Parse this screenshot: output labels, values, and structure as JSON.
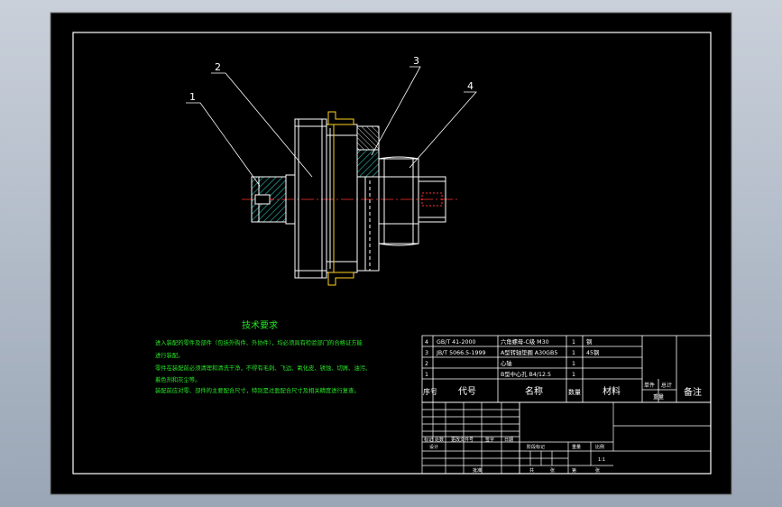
{
  "colors": {
    "outer_bg": "#a9b3c1",
    "paper": "#000000",
    "frame": "#ffffff",
    "hatch": "#2fd0c8",
    "note_text": "#27e627",
    "centerline": "#ff3333",
    "part_yellow": "#ffd21f",
    "title_block_line": "#ffffff"
  },
  "leaders": [
    {
      "num": "1"
    },
    {
      "num": "2"
    },
    {
      "num": "3"
    },
    {
      "num": "4"
    }
  ],
  "tech_requirements": {
    "title": "技术要求",
    "lines": [
      "进入装配的零件及部件（包括外购件、外协件），均必须具有检验部门的合格证方能",
      "进行装配。",
      "零件在装配前必须清理和清洗干净，不得有毛刺、飞边、氧化皮、锈蚀、切屑、油污、",
      "着色剂和灰尘等。",
      "装配前应对零、部件的主要配合尺寸，特别是过盈配合尺寸及相关精度进行复查。"
    ]
  },
  "bom": {
    "rows": [
      {
        "no": "4",
        "code": "GB/T 41-2000",
        "name": "六角螺母-C级 M30",
        "qty": "1",
        "material": "钢"
      },
      {
        "no": "3",
        "code": "JB/T 5066.5-1999",
        "name": "A型转轴垫圈 A30GB5",
        "qty": "1",
        "material": "45钢"
      },
      {
        "no": "2",
        "code": "",
        "name": "心轴",
        "qty": "1",
        "material": ""
      },
      {
        "no": "1",
        "code": "",
        "name": "B型中心孔 B4/12.5",
        "qty": "1",
        "material": ""
      }
    ],
    "header": {
      "no": "序号",
      "code": "代号",
      "name": "名称",
      "qty": "数量",
      "material": "材料",
      "unit": "单件",
      "total": "总计",
      "weight": "重量",
      "remark": "备注"
    }
  },
  "title_block": {
    "labels": {
      "mark": "标记",
      "zones": "处数",
      "change_doc": "更改文件号",
      "signature": "签字",
      "date": "日期",
      "designer": "设计",
      "stage_mark": "阶段标记",
      "weight": "重量",
      "scale": "比例",
      "scale_value": "1:1",
      "approve": "批准",
      "sheet_total": "共",
      "sheet_word": "张",
      "sheet_no": "第"
    }
  }
}
